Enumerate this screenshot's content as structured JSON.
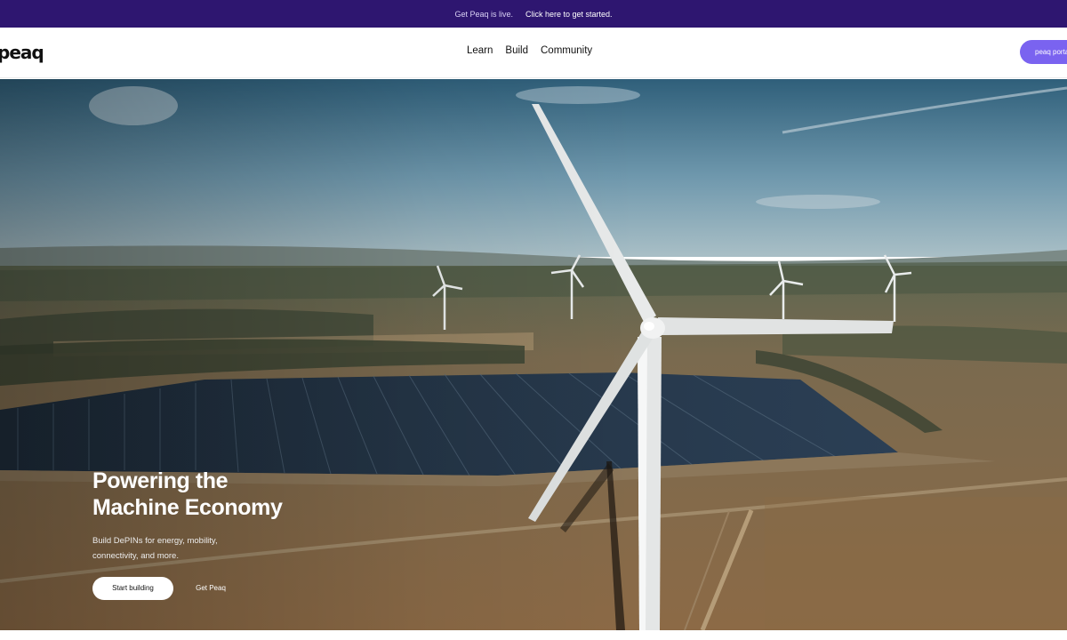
{
  "announcement": {
    "text": "Get Peaq is live.",
    "cta": "Click here to get started."
  },
  "header": {
    "logo": "peaq",
    "nav": [
      "Learn",
      "Build",
      "Community"
    ],
    "cta_label": "peaq portal"
  },
  "hero": {
    "title_line1": "Powering the",
    "title_line2": "Machine Economy",
    "subtitle": "Build DePINs for energy, mobility, connectivity, and more.",
    "primary_button": "Start building",
    "secondary_button": "Get Peaq",
    "image_alt_icon": "wind-turbine-solar-farm-image"
  },
  "colors": {
    "announcement_bg": "#2e1670",
    "accent": "#7a63f0",
    "hero_text": "#ffffff"
  }
}
